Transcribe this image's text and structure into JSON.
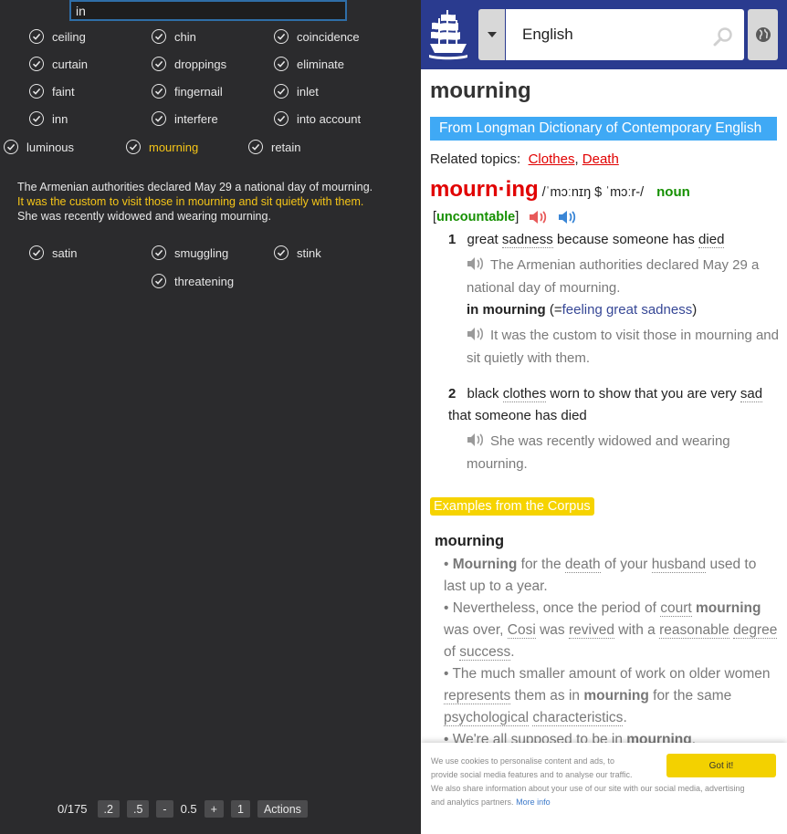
{
  "left": {
    "search_value": "in",
    "word_rows": [
      [
        "ceiling",
        "chin",
        "coincidence"
      ],
      [
        "curtain",
        "droppings",
        "eliminate"
      ],
      [
        "faint",
        "fingernail",
        "inlet"
      ],
      [
        "inn",
        "interfere",
        "into account"
      ],
      [
        "luminous",
        "mourning",
        "retain"
      ]
    ],
    "active_word": "mourning",
    "examples": [
      "The Armenian authorities declared May 29 a national day of mourning.",
      "It was the custom to visit those in mourning and sit quietly with them.",
      "She was recently widowed and wearing mourning."
    ],
    "word_rows_2": [
      [
        "satin",
        "smuggling",
        "stink"
      ],
      [
        "",
        "threatening",
        ""
      ]
    ],
    "bottom": {
      "count": "0/175",
      "btn_02": ".2",
      "btn_05": ".5",
      "btn_minus": "-",
      "speed_value": "0.5",
      "btn_plus": "+",
      "btn_1": "1",
      "btn_actions": "Actions"
    }
  },
  "right": {
    "language": "English",
    "headword": "mourning",
    "source": "From Longman Dictionary of Contemporary English",
    "related_label": "Related topics:",
    "topics": [
      "Clothes",
      "Death"
    ],
    "hw_display": "mourn·ing",
    "pronunciation": "/ˈmɔːnɪŋ $ ˈmɔːr-/",
    "pos": "noun",
    "grammar": "uncountable",
    "sense1": {
      "num": "1",
      "w1": "great",
      "w2": "sadness",
      "w3": "because someone has",
      "w4": "died",
      "ex1": "The Armenian authorities declared May 29 a national day of mourning.",
      "colloc_phrase": "in mourning",
      "colloc_open": "(=",
      "colloc_gloss": "feeling great sadness",
      "colloc_close": ")",
      "ex2": "It was the custom to visit those in mourning and sit quietly with them."
    },
    "sense2": {
      "num": "2",
      "w1": "black",
      "w2": "clothes",
      "w3": "worn to show that you are very",
      "w4": "sad",
      "w5": "that someone has died",
      "ex1": "She was recently widowed and wearing mourning."
    },
    "corpus_badge": "Examples from the Corpus",
    "corpus_word": "mourning",
    "cookie": {
      "line1": "We use cookies to personalise content and ads, to",
      "line2": "provide social media features and to analyse our traffic.",
      "line3": "We also share information about your use of our site with our social media, advertising",
      "line4": "and analytics partners.",
      "more_info": "More info",
      "got_it": "Got it!"
    }
  }
}
